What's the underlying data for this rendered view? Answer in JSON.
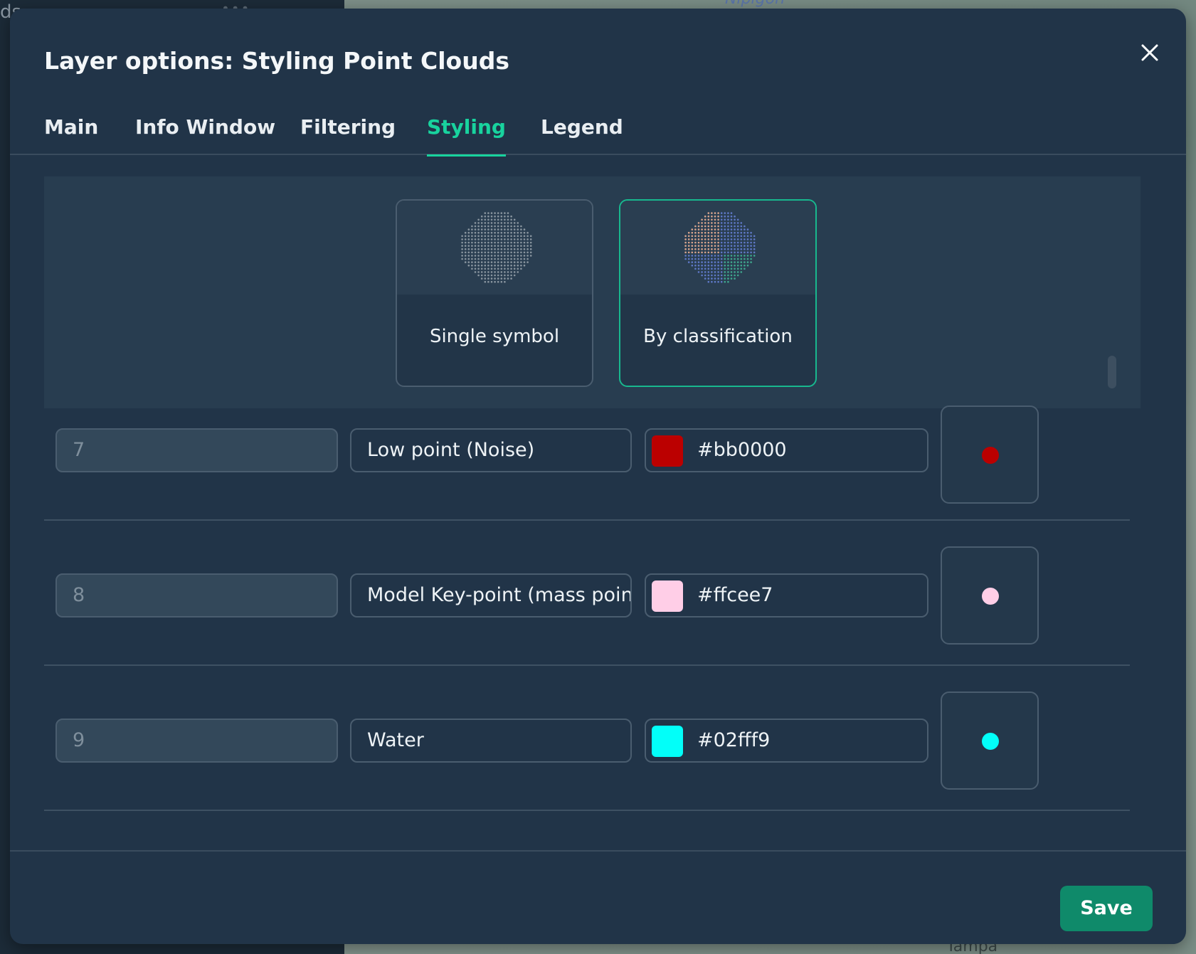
{
  "background": {
    "app_text": "ds",
    "app_dots": "•••",
    "map_label_top": "Nipigon",
    "map_label_bottom": "Tampa"
  },
  "modal": {
    "title": "Layer options: Styling Point Clouds",
    "close_icon": "close-icon"
  },
  "tabs": [
    {
      "label": "Main",
      "active": false
    },
    {
      "label": "Info Window",
      "active": false
    },
    {
      "label": "Filtering",
      "active": false
    },
    {
      "label": "Styling",
      "active": true
    },
    {
      "label": "Legend",
      "active": false
    }
  ],
  "styling_modes": [
    {
      "label": "Single symbol",
      "icon": "point-cloud-single-icon",
      "selected": false
    },
    {
      "label": "By classification",
      "icon": "point-cloud-classified-icon",
      "selected": true
    }
  ],
  "classes": [
    {
      "code": "7",
      "label": "Low point (Noise)",
      "color": "#bb0000"
    },
    {
      "code": "8",
      "label": "Model Key-point (mass point)",
      "color": "#ffcee7"
    },
    {
      "code": "9",
      "label": "Water",
      "color": "#02fff9"
    }
  ],
  "footer": {
    "save_label": "Save"
  },
  "colors": {
    "accent": "#18d39e",
    "save_button": "#0f8a6a",
    "modal_bg": "#213448"
  }
}
